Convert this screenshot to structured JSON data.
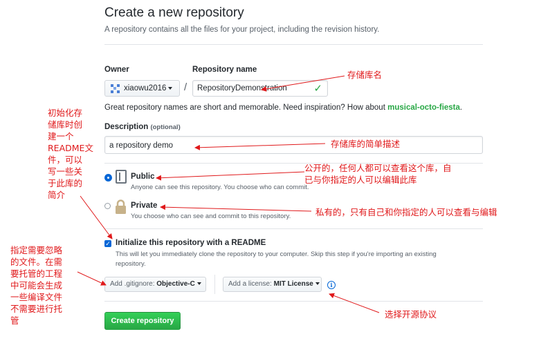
{
  "header": {
    "title": "Create a new repository",
    "subtitle": "A repository contains all the files for your project, including the revision history."
  },
  "owner": {
    "label": "Owner",
    "value": "xiaowu2016"
  },
  "separator": "/",
  "repo_name": {
    "label": "Repository name",
    "value": "RepositoryDemonstration"
  },
  "name_hint": {
    "text": "Great repository names are short and memorable. Need inspiration? How about ",
    "suggestion": "musical-octo-fiesta",
    "end": "."
  },
  "description": {
    "label": "Description",
    "optional": "(optional)",
    "value": "a repository demo"
  },
  "visibility": {
    "public": {
      "title": "Public",
      "desc": "Anyone can see this repository. You choose who can commit.",
      "selected": true
    },
    "private": {
      "title": "Private",
      "desc": "You choose who can see and commit to this repository.",
      "selected": false
    }
  },
  "readme": {
    "label": "Initialize this repository with a README",
    "desc_line1": "This will let you immediately clone the repository to your computer. Skip this step if you're importing an existing",
    "desc_line2": "repository.",
    "checked": true
  },
  "gitignore": {
    "prefix": "Add .gitignore: ",
    "value": "Objective-C"
  },
  "license": {
    "prefix": "Add a license: ",
    "value": "MIT License"
  },
  "create_button": "Create repository",
  "annotations": {
    "repo_name": "存储库名",
    "description": "存储库的简单描述",
    "public_line1": "公开的，任何人都可以查看这个库，自",
    "public_line2": "已与你指定的人可以编辑此库",
    "private": "私有的，只有自己和你指定的人可以查看与编辑",
    "readme": [
      "初始化存",
      "储库时创",
      "建一个",
      "README文",
      "件，可以",
      "写一些关",
      "于此库的",
      "简介"
    ],
    "gitignore": [
      "指定需要忽略",
      "的文件。在需",
      "要托管的工程",
      "中可能会生成",
      "一些编译文件",
      "不需要进行托",
      "管"
    ],
    "license": "选择开源协议"
  },
  "colors": {
    "annotation": "#e0191b",
    "accent": "#0366d6",
    "success": "#28a745"
  }
}
